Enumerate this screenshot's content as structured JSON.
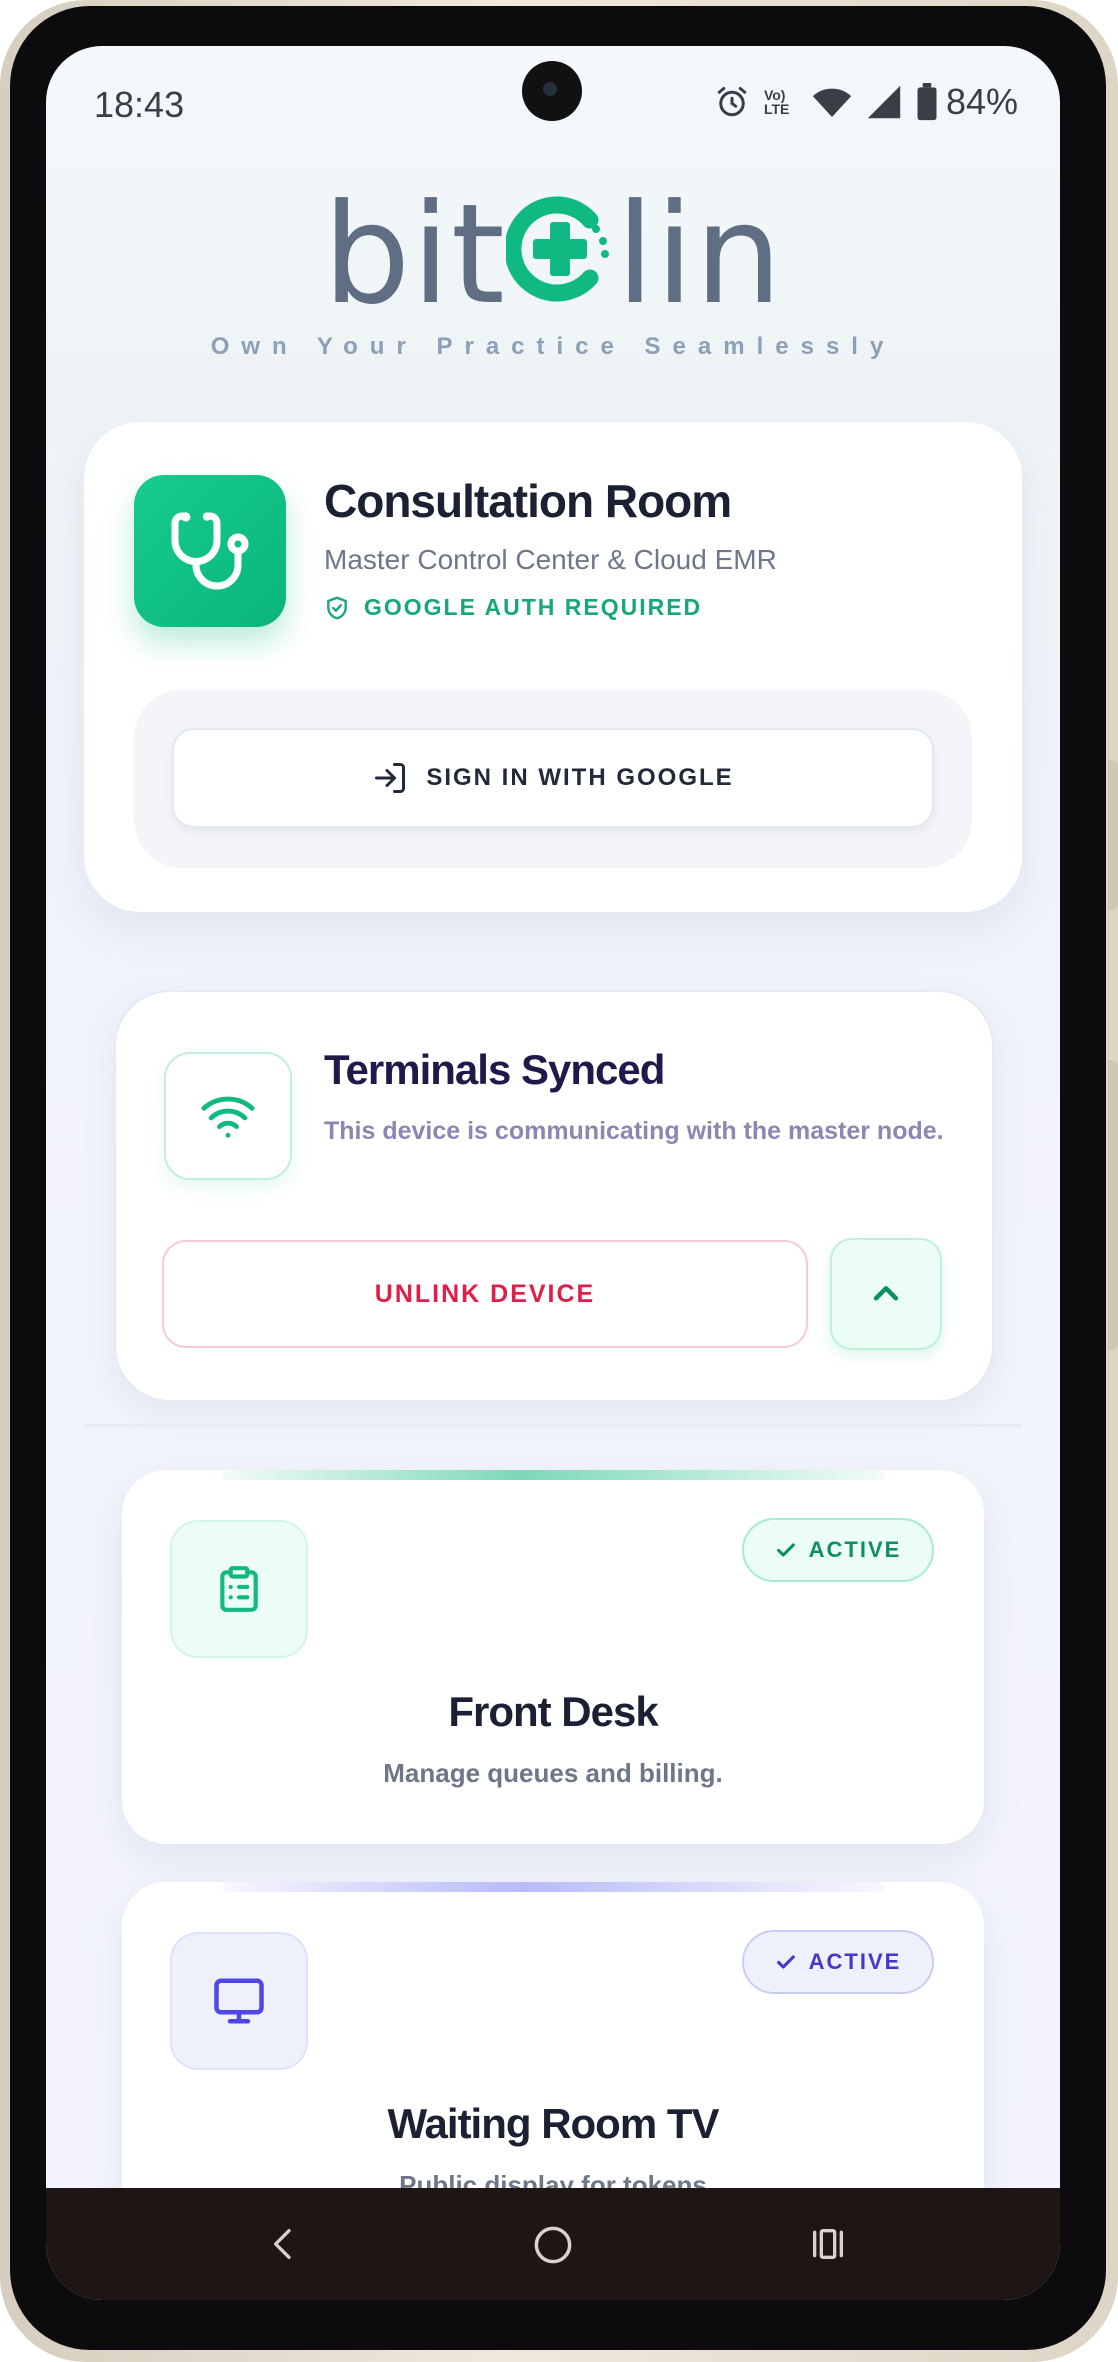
{
  "status_bar": {
    "time": "18:43",
    "battery_percent": "84%",
    "volte_label": "Vo) LTE",
    "icons": [
      "alarm-icon",
      "volte-icon",
      "wifi-icon",
      "signal-icon",
      "battery-icon"
    ]
  },
  "logo": {
    "word_left": "bit",
    "word_right": "lin",
    "tagline": "Own Your Practice Seamlessly"
  },
  "auth_card": {
    "title": "Consultation Room",
    "subtitle": "Master Control Center & Cloud EMR",
    "notice": "GOOGLE AUTH REQUIRED",
    "signin_label": "SIGN IN WITH GOOGLE"
  },
  "sync_card": {
    "title": "Terminals Synced",
    "description": "This device is communicating with the master node.",
    "unlink_label": "UNLINK DEVICE"
  },
  "modules": [
    {
      "title": "Front Desk",
      "description": "Manage queues and billing.",
      "badge": "ACTIVE",
      "icon": "clipboard-icon",
      "accent": "#10b981"
    },
    {
      "title": "Waiting Room TV",
      "description": "Public display for tokens",
      "badge": "ACTIVE",
      "icon": "monitor-icon",
      "accent": "#4f46e5"
    }
  ],
  "colors": {
    "brand_green": "#10b981",
    "logo_gray": "#5f6e82",
    "danger": "#e11d48",
    "indigo": "#4f46e5"
  }
}
